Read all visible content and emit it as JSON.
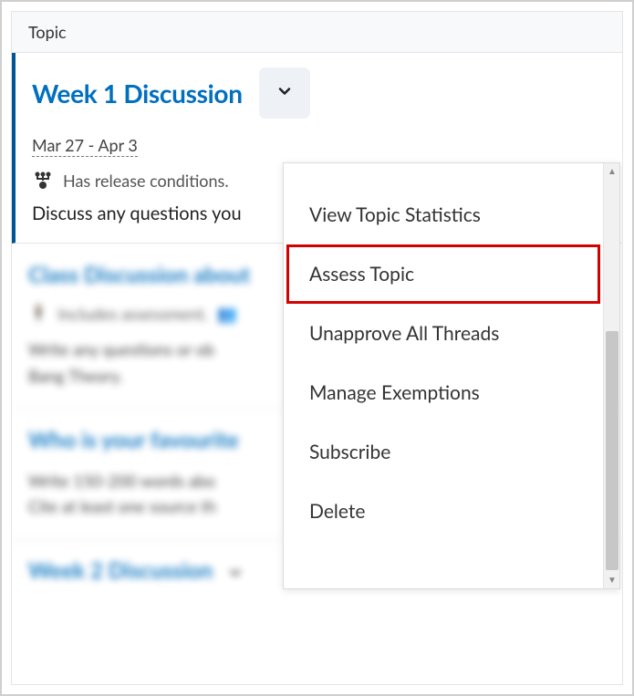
{
  "header": {
    "label": "Topic"
  },
  "topic1": {
    "title": "Week 1 Discussion",
    "date_range": "Mar 27 - Apr 3",
    "conditions_label": "Has release conditions.",
    "description": "Discuss any questions you"
  },
  "menu": {
    "items": [
      {
        "label": "View Topic Statistics",
        "highlight": false
      },
      {
        "label": "Assess Topic",
        "highlight": true
      },
      {
        "label": "Unapprove All Threads",
        "highlight": false
      },
      {
        "label": "Manage Exemptions",
        "highlight": false
      },
      {
        "label": "Subscribe",
        "highlight": false
      },
      {
        "label": "Delete",
        "highlight": false
      }
    ]
  },
  "blur": {
    "card1": {
      "title": "Class Discussion about",
      "meta": "Includes assessment.",
      "line1": "Write any questions or ob",
      "line2": "Bang Theory."
    },
    "card2": {
      "title": "Who is your favourite",
      "line1": "Write 150-200 words abo",
      "line2": "Cite at least one source th"
    },
    "card3": {
      "title": "Week 2 Discussion"
    }
  }
}
